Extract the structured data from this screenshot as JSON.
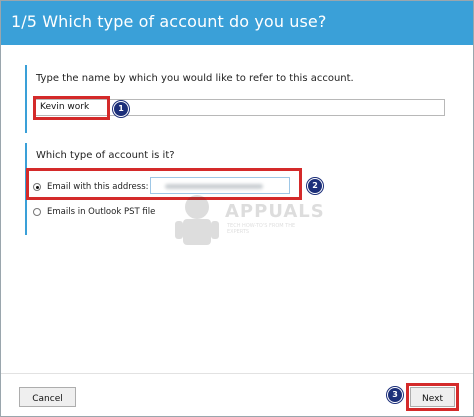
{
  "wizard": {
    "title": "1/5  Which type of account do you use?"
  },
  "name_section": {
    "prompt": "Type the name by which you would like to refer to this account.",
    "value": "Kevin work"
  },
  "account_type_section": {
    "prompt": "Which type of account is it?",
    "options": [
      {
        "label": "Email with this address:",
        "selected": true
      },
      {
        "label": "Emails in Outlook PST file",
        "selected": false
      }
    ]
  },
  "annotations": {
    "badges": [
      "1",
      "2",
      "3"
    ],
    "highlight_color": "#d42a2a",
    "badge_color": "#1c2f7a"
  },
  "watermark": {
    "text": "APPUALS",
    "subtext": "TECH HOW-TO'S FROM THE EXPERTS"
  },
  "footer": {
    "cancel_label": "Cancel",
    "next_label": "Next"
  },
  "colors": {
    "accent": "#3aa0d8"
  }
}
